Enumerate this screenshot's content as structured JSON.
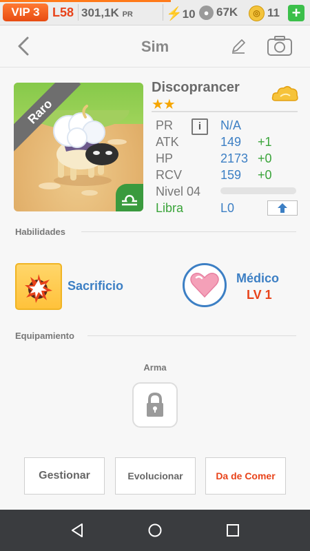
{
  "statusbar": {
    "vip": "VIP 3",
    "level": "L58",
    "power_value": "301,1K",
    "power_unit": "PR",
    "energy": "10",
    "food": "67K",
    "coins": "11",
    "plus": "+",
    "level_progress_percent": 55
  },
  "header": {
    "title": "Sim"
  },
  "pet": {
    "name": "Discoprancer",
    "rarity": "Raro",
    "stars": "★★",
    "star_count": 2,
    "element_icon": "cloud-icon",
    "zodiac_symbol": "♎",
    "stats": {
      "pr_label": "PR",
      "pr_value": "N/A",
      "info_label": "i",
      "atk_label": "ATK",
      "atk_value": "149",
      "atk_bonus": "+1",
      "hp_label": "HP",
      "hp_value": "2173",
      "hp_bonus": "+0",
      "rcv_label": "RCV",
      "rcv_value": "159",
      "rcv_bonus": "+0",
      "level_label": "Nivel 04",
      "level_progress_percent": 0,
      "sign_label": "Libra",
      "sign_value": "L0"
    }
  },
  "skills": {
    "section_title": "Habilidades",
    "active_name": "Sacrificio",
    "leader_name": "Médico",
    "leader_level": "LV 1"
  },
  "equipment": {
    "section_title": "Equipamiento",
    "slot_label": "Arma"
  },
  "actions": {
    "manage": "Gestionar",
    "evolve": "Evolucionar",
    "feed": "Da de Comer"
  },
  "colors": {
    "accent_blue": "#3c7fc4",
    "accent_red": "#e8431a",
    "green": "#3aa43a",
    "vip_orange": "#e84c12"
  }
}
